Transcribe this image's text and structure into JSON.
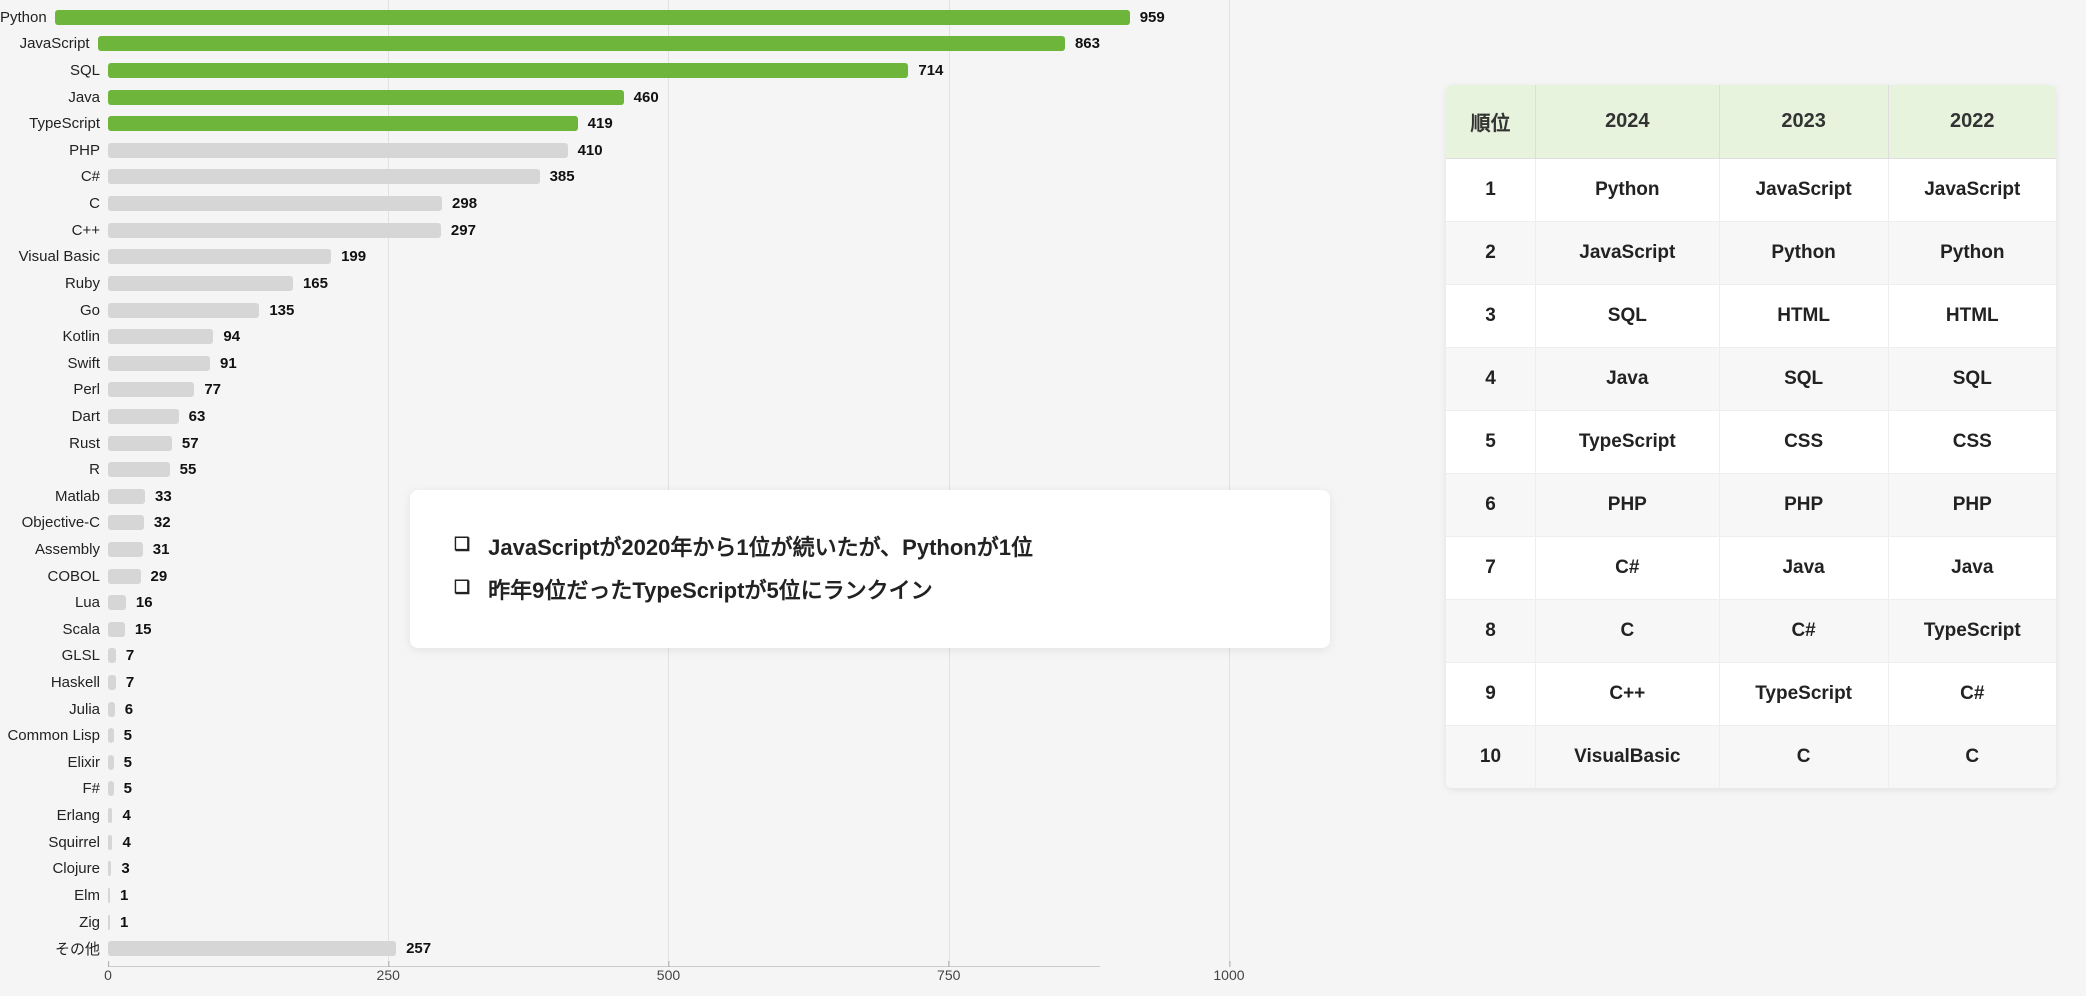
{
  "chart_data": {
    "type": "bar",
    "xlim": [
      0,
      1000
    ],
    "xticks": [
      0,
      250,
      500,
      750,
      1000
    ],
    "highlight_top_n": 5,
    "bars": [
      {
        "label": "Python",
        "value": 959,
        "color": "green"
      },
      {
        "label": "JavaScript",
        "value": 863,
        "color": "green"
      },
      {
        "label": "SQL",
        "value": 714,
        "color": "green"
      },
      {
        "label": "Java",
        "value": 460,
        "color": "green"
      },
      {
        "label": "TypeScript",
        "value": 419,
        "color": "green"
      },
      {
        "label": "PHP",
        "value": 410,
        "color": "gray"
      },
      {
        "label": "C#",
        "value": 385,
        "color": "gray"
      },
      {
        "label": "C",
        "value": 298,
        "color": "gray"
      },
      {
        "label": "C++",
        "value": 297,
        "color": "gray"
      },
      {
        "label": "Visual Basic",
        "value": 199,
        "color": "gray"
      },
      {
        "label": "Ruby",
        "value": 165,
        "color": "gray"
      },
      {
        "label": "Go",
        "value": 135,
        "color": "gray"
      },
      {
        "label": "Kotlin",
        "value": 94,
        "color": "gray"
      },
      {
        "label": "Swift",
        "value": 91,
        "color": "gray"
      },
      {
        "label": "Perl",
        "value": 77,
        "color": "gray"
      },
      {
        "label": "Dart",
        "value": 63,
        "color": "gray"
      },
      {
        "label": "Rust",
        "value": 57,
        "color": "gray"
      },
      {
        "label": "R",
        "value": 55,
        "color": "gray"
      },
      {
        "label": "Matlab",
        "value": 33,
        "color": "gray"
      },
      {
        "label": "Objective-C",
        "value": 32,
        "color": "gray"
      },
      {
        "label": "Assembly",
        "value": 31,
        "color": "gray"
      },
      {
        "label": "COBOL",
        "value": 29,
        "color": "gray"
      },
      {
        "label": "Lua",
        "value": 16,
        "color": "gray"
      },
      {
        "label": "Scala",
        "value": 15,
        "color": "gray"
      },
      {
        "label": "GLSL",
        "value": 7,
        "color": "gray"
      },
      {
        "label": "Haskell",
        "value": 7,
        "color": "gray"
      },
      {
        "label": "Julia",
        "value": 6,
        "color": "gray"
      },
      {
        "label": "Common Lisp",
        "value": 5,
        "color": "gray"
      },
      {
        "label": "Elixir",
        "value": 5,
        "color": "gray"
      },
      {
        "label": "F#",
        "value": 5,
        "color": "gray"
      },
      {
        "label": "Erlang",
        "value": 4,
        "color": "gray"
      },
      {
        "label": "Squirrel",
        "value": 4,
        "color": "gray"
      },
      {
        "label": "Clojure",
        "value": 3,
        "color": "gray"
      },
      {
        "label": "Elm",
        "value": 1,
        "color": "gray"
      },
      {
        "label": "Zig",
        "value": 1,
        "color": "gray"
      },
      {
        "label": "その他",
        "value": 257,
        "color": "gray"
      }
    ]
  },
  "annotations": [
    "JavaScriptが2020年から1位が続いたが、Pythonが1位",
    "昨年9位だったTypeScriptが5位にランクイン"
  ],
  "ranking": {
    "headers": [
      "順位",
      "2024",
      "2023",
      "2022"
    ],
    "rows": [
      [
        "1",
        "Python",
        "JavaScript",
        "JavaScript"
      ],
      [
        "2",
        "JavaScript",
        "Python",
        "Python"
      ],
      [
        "3",
        "SQL",
        "HTML",
        "HTML"
      ],
      [
        "4",
        "Java",
        "SQL",
        "SQL"
      ],
      [
        "5",
        "TypeScript",
        "CSS",
        "CSS"
      ],
      [
        "6",
        "PHP",
        "PHP",
        "PHP"
      ],
      [
        "7",
        "C#",
        "Java",
        "Java"
      ],
      [
        "8",
        "C",
        "C#",
        "TypeScript"
      ],
      [
        "9",
        "C++",
        "TypeScript",
        "C#"
      ],
      [
        "10",
        "VisualBasic",
        "C",
        "C"
      ]
    ]
  }
}
